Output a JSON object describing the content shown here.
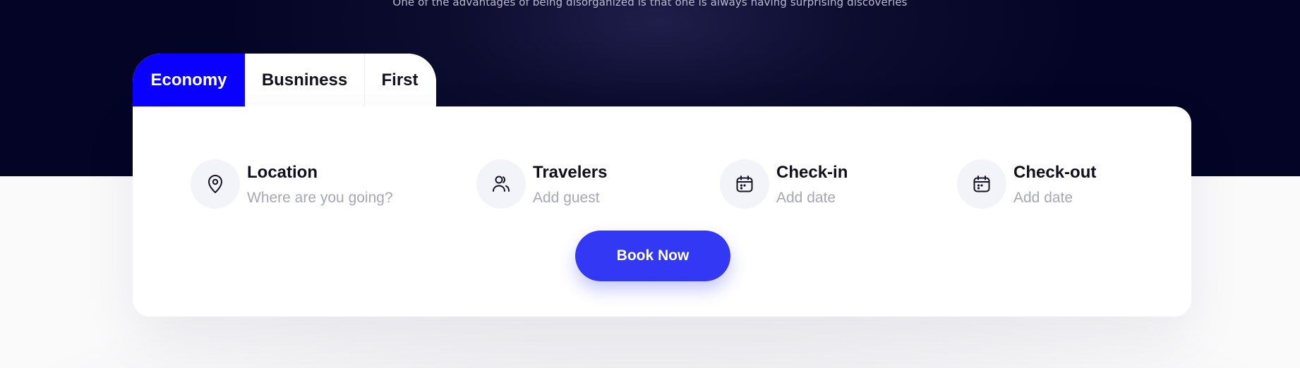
{
  "hero": {
    "tagline": "One of the advantages of being disorganized is that one is always having surprising discoveries"
  },
  "tabs": [
    {
      "label": "Economy",
      "active": true
    },
    {
      "label": "Busniness",
      "active": false
    },
    {
      "label": "First",
      "active": false
    }
  ],
  "fields": {
    "location": {
      "label": "Location",
      "placeholder": "Where are you going?",
      "icon": "location-pin-icon"
    },
    "travelers": {
      "label": "Travelers",
      "placeholder": "Add guest",
      "icon": "users-icon"
    },
    "checkin": {
      "label": "Check-in",
      "placeholder": "Add date",
      "icon": "calendar-icon"
    },
    "checkout": {
      "label": "Check-out",
      "placeholder": "Add date",
      "icon": "calendar-icon"
    }
  },
  "actions": {
    "book_label": "Book Now"
  },
  "colors": {
    "hero_bg": "#040426",
    "tab_active": "#0a00ff",
    "button": "#3338f5",
    "placeholder": "#a6a7b7"
  }
}
